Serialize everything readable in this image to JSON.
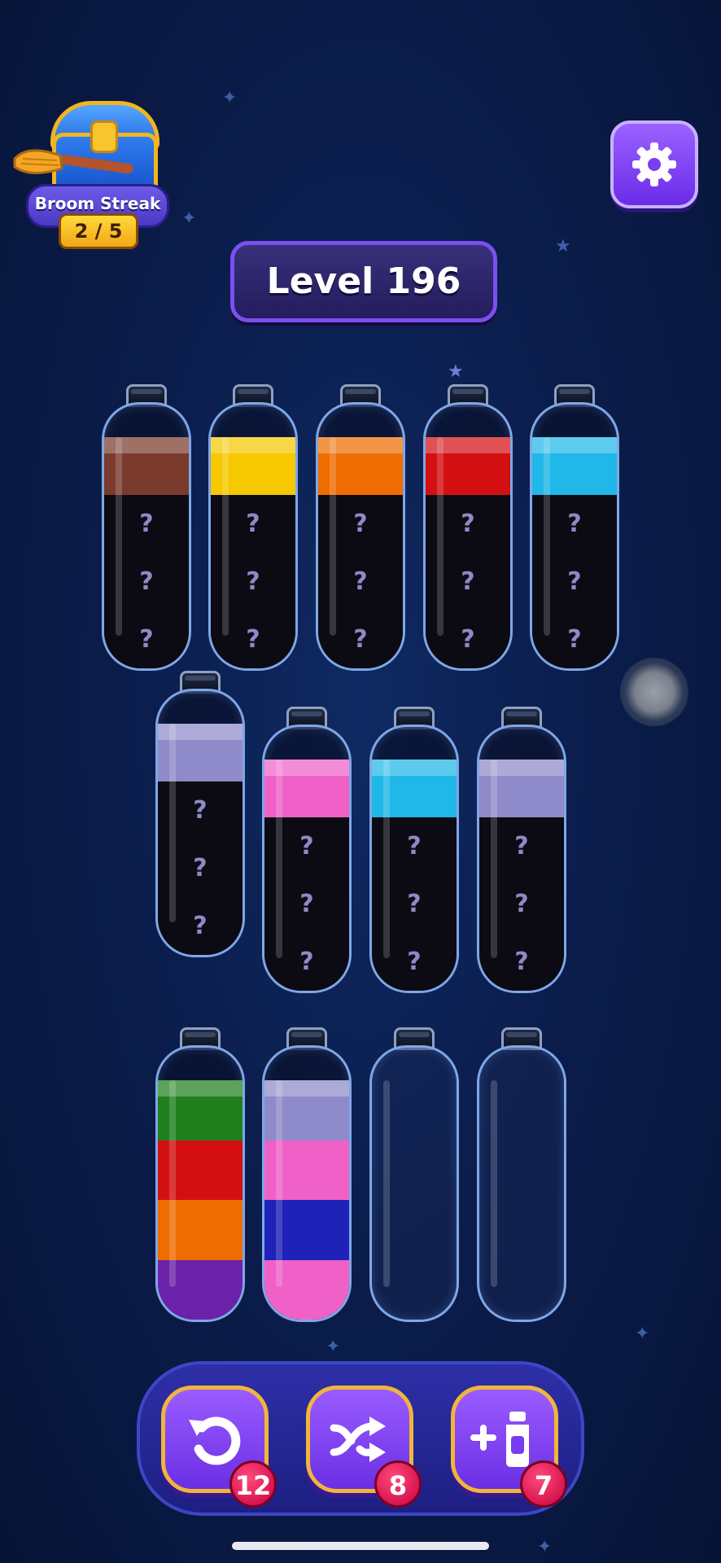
{
  "streak": {
    "title": "Broom Streak",
    "progress": "2 / 5",
    "icon": "treasure-chest-icon"
  },
  "settings": {
    "icon": "gear-icon"
  },
  "level": {
    "label": "Level 196"
  },
  "hidden_mark": "?",
  "colors": {
    "brown": "#7a3a2c",
    "yellow": "#f5c800",
    "orange": "#ef6c00",
    "red": "#d40f12",
    "cyan": "#1fb8e8",
    "lavender": "#8f8ac9",
    "pink": "#f061c8",
    "green": "#1f7f1d",
    "purple": "#6a23a8",
    "blue": "#1f22b8"
  },
  "tubes": [
    {
      "id": 1,
      "capacity": 4,
      "layers": [
        "brown",
        "?",
        "?",
        "?"
      ]
    },
    {
      "id": 2,
      "capacity": 4,
      "layers": [
        "yellow",
        "?",
        "?",
        "?"
      ]
    },
    {
      "id": 3,
      "capacity": 4,
      "layers": [
        "orange",
        "?",
        "?",
        "?"
      ]
    },
    {
      "id": 4,
      "capacity": 4,
      "layers": [
        "red",
        "?",
        "?",
        "?"
      ]
    },
    {
      "id": 5,
      "capacity": 4,
      "layers": [
        "cyan",
        "?",
        "?",
        "?"
      ]
    },
    {
      "id": 6,
      "capacity": 4,
      "layers": [
        "lavender",
        "?",
        "?",
        "?"
      ]
    },
    {
      "id": 7,
      "capacity": 4,
      "layers": [
        "pink",
        "?",
        "?",
        "?"
      ]
    },
    {
      "id": 8,
      "capacity": 4,
      "layers": [
        "cyan",
        "?",
        "?",
        "?"
      ]
    },
    {
      "id": 9,
      "capacity": 4,
      "layers": [
        "lavender",
        "?",
        "?",
        "?"
      ]
    },
    {
      "id": 10,
      "capacity": 4,
      "layers": [
        "green",
        "red",
        "orange",
        "purple"
      ]
    },
    {
      "id": 11,
      "capacity": 4,
      "layers": [
        "lavender",
        "pink",
        "blue",
        "pink"
      ]
    },
    {
      "id": 12,
      "capacity": 4,
      "layers": []
    },
    {
      "id": 13,
      "capacity": 4,
      "layers": []
    }
  ],
  "powerups": {
    "undo": {
      "icon": "undo-icon",
      "count": "12"
    },
    "shuffle": {
      "icon": "shuffle-icon",
      "count": "8"
    },
    "add_tube": {
      "icon": "add-tube-icon",
      "count": "7"
    }
  }
}
